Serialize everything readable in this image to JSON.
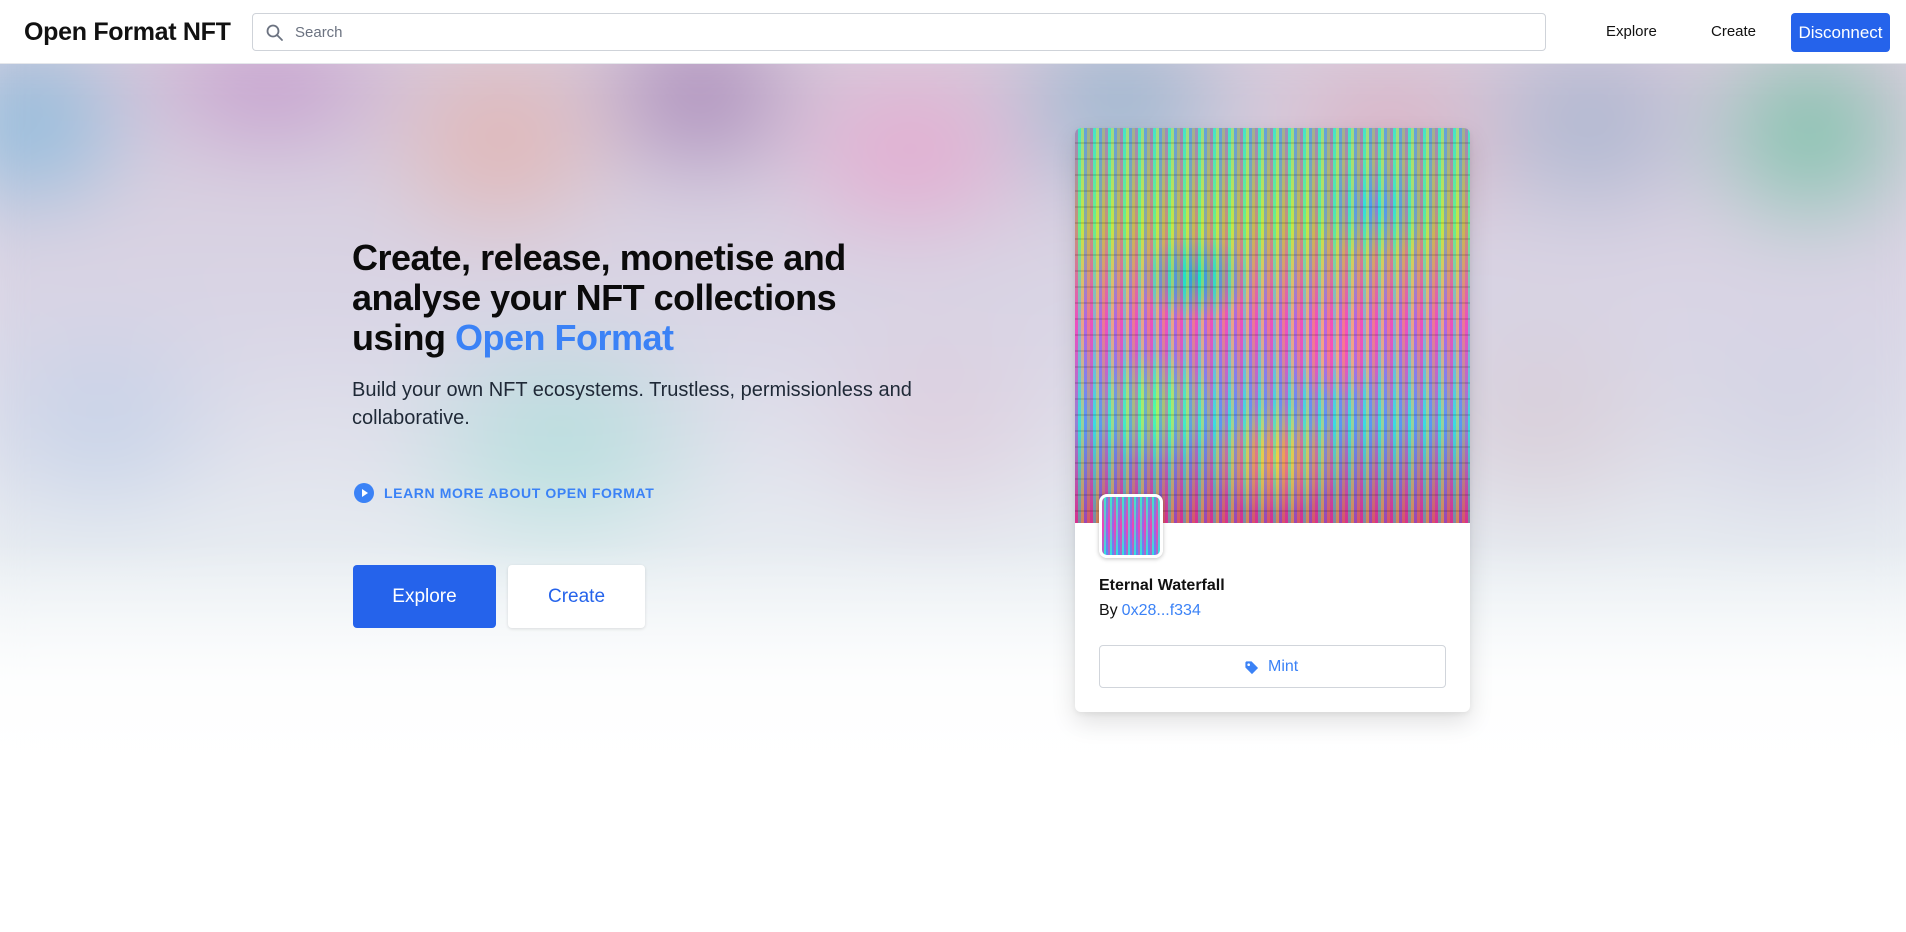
{
  "header": {
    "brand": "Open Format NFT",
    "search_placeholder": "Search",
    "nav": {
      "explore_label": "Explore",
      "create_label": "Create",
      "disconnect_label": "Disconnect"
    }
  },
  "hero": {
    "headline_main": "Create, release, monetise and analyse your NFT collections using ",
    "headline_accent": "Open Format",
    "subtitle": "Build your own NFT ecosystems. Trustless, permissionless and collaborative.",
    "learn_more_label": "LEARN MORE ABOUT OPEN FORMAT",
    "explore_button_label": "Explore",
    "create_button_label": "Create"
  },
  "nft_card": {
    "title": "Eternal Waterfall",
    "by_prefix": "By",
    "creator_address": "0x28...f334",
    "mint_label": "Mint"
  },
  "colors": {
    "primary": "#2563eb",
    "accent_text": "#3b82f6",
    "text": "#111111",
    "border": "#d1d5db"
  },
  "icons": {
    "search": "search-icon",
    "play": "play-circle-icon",
    "mint": "tag-icon"
  }
}
